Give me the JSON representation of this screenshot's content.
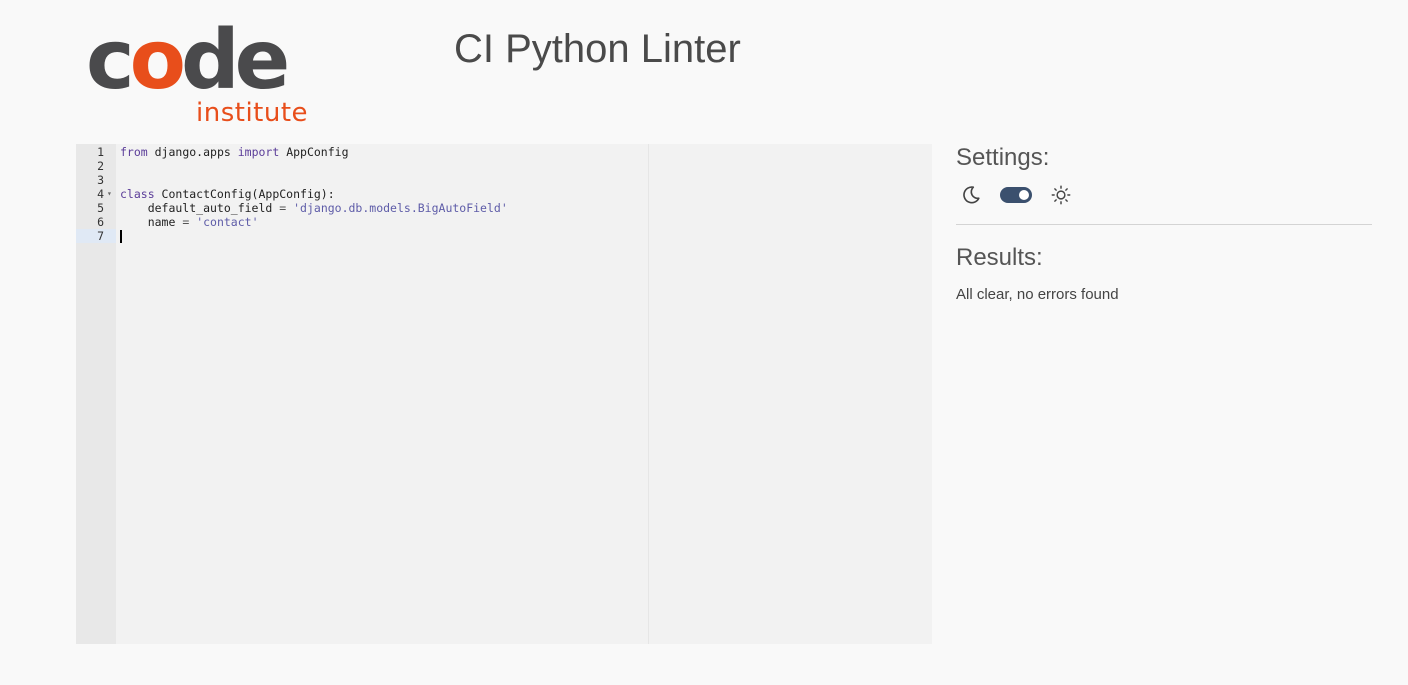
{
  "logo": {
    "code_prefix": "c",
    "code_o": "o",
    "code_suffix": "de",
    "institute": "institute"
  },
  "title": "CI Python Linter",
  "editor": {
    "lines": [
      {
        "num": "1",
        "tokens": [
          {
            "t": "kw",
            "v": "from"
          },
          {
            "t": "plain",
            "v": " django.apps "
          },
          {
            "t": "kw",
            "v": "import"
          },
          {
            "t": "plain",
            "v": " AppConfig"
          }
        ]
      },
      {
        "num": "2",
        "tokens": []
      },
      {
        "num": "3",
        "tokens": []
      },
      {
        "num": "4",
        "fold": true,
        "tokens": [
          {
            "t": "kw",
            "v": "class"
          },
          {
            "t": "plain",
            "v": " ContactConfig(AppConfig):"
          }
        ]
      },
      {
        "num": "5",
        "tokens": [
          {
            "t": "plain",
            "v": "    default_auto_field "
          },
          {
            "t": "op",
            "v": "="
          },
          {
            "t": "plain",
            "v": " "
          },
          {
            "t": "str",
            "v": "'django.db.models.BigAutoField'"
          }
        ]
      },
      {
        "num": "6",
        "tokens": [
          {
            "t": "plain",
            "v": "    name "
          },
          {
            "t": "op",
            "v": "="
          },
          {
            "t": "plain",
            "v": " "
          },
          {
            "t": "str",
            "v": "'contact'"
          }
        ]
      },
      {
        "num": "7",
        "active": true,
        "tokens": []
      }
    ],
    "fold_icon": "fold-arrow-icon"
  },
  "settings": {
    "title": "Settings:",
    "dark_icon": "moon-icon",
    "light_icon": "sun-icon",
    "toggle_state": "on"
  },
  "results": {
    "title": "Results:",
    "message": "All clear, no errors found"
  },
  "colors": {
    "brand_orange": "#e84e1b",
    "brand_gray": "#4a4a4c",
    "toggle": "#3b506e",
    "keyword": "#5b3d99",
    "string": "#5e5ca8"
  }
}
